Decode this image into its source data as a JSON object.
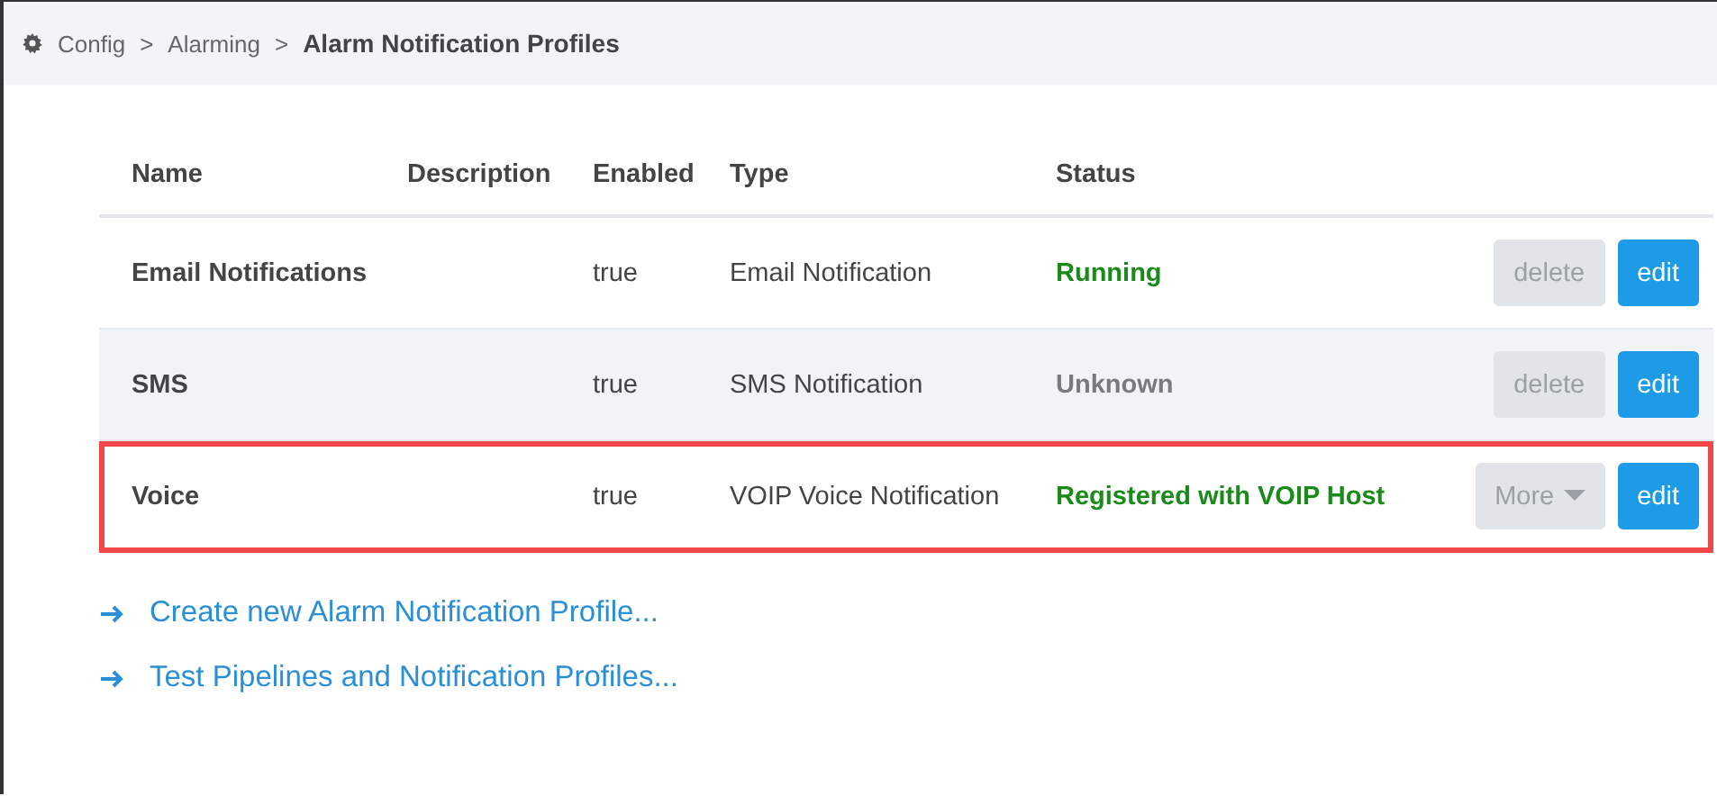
{
  "breadcrumb": {
    "items": [
      "Config",
      "Alarming"
    ],
    "separator": ">",
    "current": "Alarm Notification Profiles"
  },
  "table": {
    "columns": [
      "Name",
      "Description",
      "Enabled",
      "Type",
      "Status"
    ],
    "rows": [
      {
        "name": "Email Notifications",
        "enabled": "true",
        "type": "Email Notification",
        "status": "Running",
        "color": "#1a8a1a",
        "highlighted": false,
        "actions": [
          {
            "kind": "delete",
            "label": "delete"
          },
          {
            "kind": "edit",
            "label": "edit"
          }
        ]
      },
      {
        "name": "SMS",
        "enabled": "true",
        "type": "SMS Notification",
        "status": "Unknown",
        "color": "#7a7a7a",
        "highlighted": false,
        "actions": [
          {
            "kind": "delete",
            "label": "delete"
          },
          {
            "kind": "edit",
            "label": "edit"
          }
        ]
      },
      {
        "name": "Voice",
        "enabled": "true",
        "type": "VOIP Voice Notification",
        "status": "Registered with VOIP Host",
        "color": "#1a8a1a",
        "highlighted": true,
        "actions": [
          {
            "kind": "more",
            "label": "More"
          },
          {
            "kind": "edit",
            "label": "edit"
          }
        ]
      }
    ]
  },
  "links": [
    "Create new Alarm Notification Profile...",
    "Test Pipelines and Notification Profiles..."
  ]
}
